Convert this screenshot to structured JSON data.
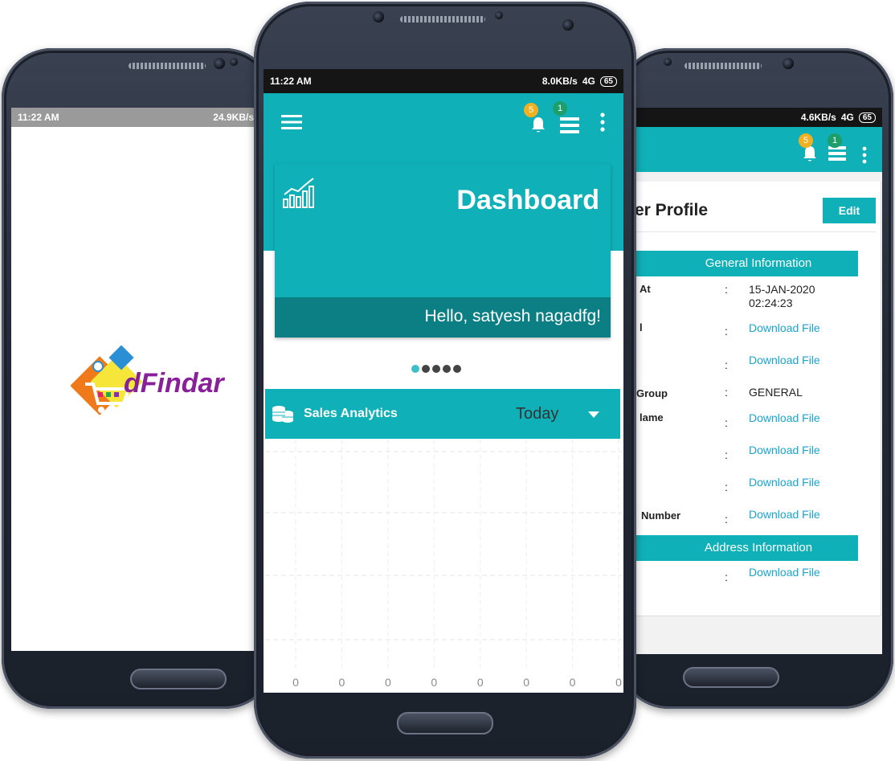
{
  "left_phone": {
    "status": {
      "time": "11:22 AM",
      "speed": "24.9KB/s"
    },
    "logo_text": "dFindar"
  },
  "center_phone": {
    "status": {
      "time": "11:22 AM",
      "speed": "8.0KB/s",
      "network": "4G",
      "battery": "65"
    },
    "header": {
      "notif_count": "5",
      "list_count": "1"
    },
    "dashboard": {
      "title": "Dashboard",
      "greeting": "Hello, satyesh nagadfg!"
    },
    "carousel": {
      "dots": 5,
      "active_index": 0
    },
    "sales": {
      "title": "Sales Analytics",
      "period": "Today"
    },
    "chart_data": {
      "type": "bar",
      "title": "",
      "categories": [
        "",
        "",
        "",
        "",
        "",
        "",
        "",
        ""
      ],
      "values": [
        0,
        0,
        0,
        0,
        0,
        0,
        0,
        0
      ],
      "tick_labels": [
        "0",
        "0",
        "0",
        "0",
        "0",
        "0",
        "0",
        "0"
      ],
      "grid": true
    }
  },
  "right_phone": {
    "status": {
      "speed": "4.6KB/s",
      "network": "4G",
      "battery": "65"
    },
    "header": {
      "notif_count": "5",
      "list_count": "1"
    },
    "profile": {
      "title": "er Profile",
      "edit_label": "Edit"
    },
    "general_section": "General Information",
    "rows": [
      {
        "label": "At",
        "colon": ":",
        "value": "15-JAN-2020\n02:24:23",
        "type": "text"
      },
      {
        "label": "l",
        "colon": ":",
        "value": "Download File",
        "type": "link"
      },
      {
        "label": "",
        "colon": ":",
        "value": "Download File",
        "type": "link"
      },
      {
        "label": "Group",
        "colon": ":",
        "value": "GENERAL",
        "type": "text"
      },
      {
        "label": "lame",
        "colon": ":",
        "value": "Download File",
        "type": "link"
      },
      {
        "label": "",
        "colon": ":",
        "value": "Download File",
        "type": "link"
      },
      {
        "label": "",
        "colon": ":",
        "value": "Download File",
        "type": "link"
      },
      {
        "label": "Number",
        "colon": ":",
        "value": "Download File",
        "type": "link"
      }
    ],
    "address_section": "Address Information",
    "address_rows": [
      {
        "label": "",
        "colon": ":",
        "value": "Download File",
        "type": "link"
      }
    ]
  },
  "colors": {
    "teal": "#10b0b8",
    "teal_dark": "#0b7f84",
    "link": "#1aa3cf",
    "badge_yellow": "#f0b022",
    "badge_green": "#1e9e6a"
  }
}
